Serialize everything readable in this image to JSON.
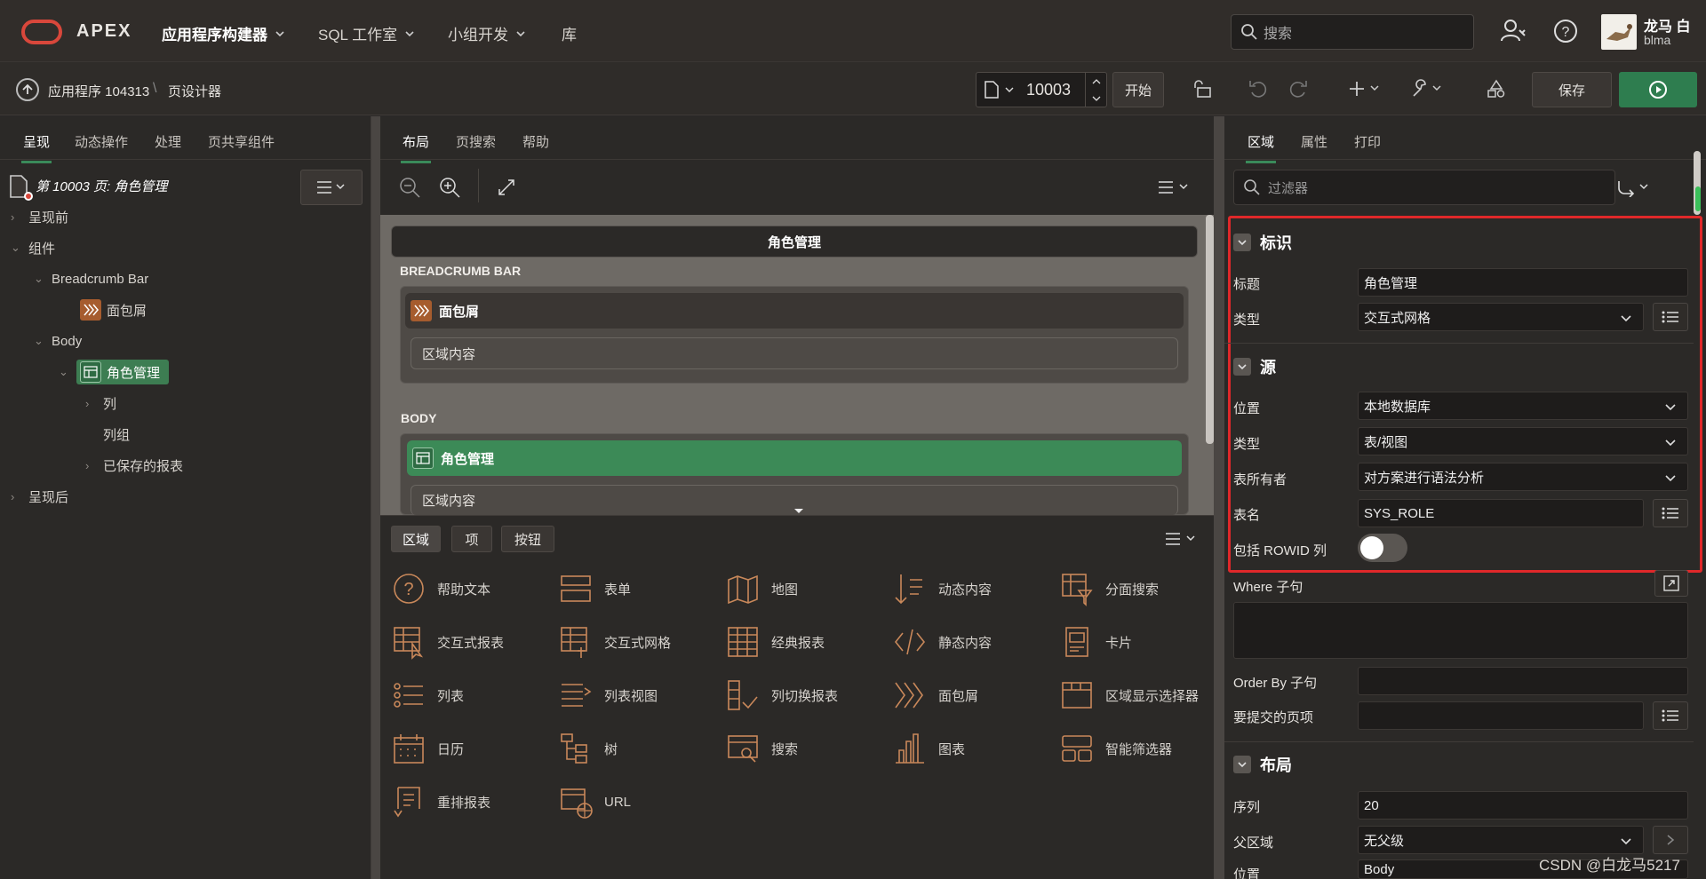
{
  "topnav": {
    "brand": "APEX",
    "menu": [
      {
        "label": "应用程序构建器",
        "active": true
      },
      {
        "label": "SQL 工作室",
        "active": false
      },
      {
        "label": "小组开发",
        "active": false
      },
      {
        "label": "库",
        "active": false
      }
    ],
    "search_placeholder": "搜索",
    "user_name": "龙马 白",
    "user_id": "blma"
  },
  "toolbar": {
    "back_label": "应用程序 104313",
    "separator": "\\",
    "breadcrumb_current": "页设计器",
    "page_number": "10003",
    "go_label": "开始",
    "save_label": "保存"
  },
  "left": {
    "tabs": [
      "呈现",
      "动态操作",
      "处理",
      "页共享组件"
    ],
    "page_title": "第 10003 页: 角色管理",
    "tree": {
      "pre_render": "呈现前",
      "components": "组件",
      "breadcrumb_bar": "Breadcrumb Bar",
      "breadcrumb_item": "面包屑",
      "body": "Body",
      "body_item": "角色管理",
      "columns": "列",
      "column_groups": "列组",
      "saved_reports": "已保存的报表",
      "post_render": "呈现后"
    }
  },
  "center": {
    "tabs": [
      "布局",
      "页搜索",
      "帮助"
    ],
    "canvas": {
      "page_header": "角色管理",
      "breadcrumb_bar_label": "BREADCRUMB BAR",
      "breadcrumb_region": "面包屑",
      "region_content_1": "区域内容",
      "body_label": "BODY",
      "body_region": "角色管理",
      "region_content_2": "区域内容"
    },
    "gallery_tabs": [
      "区域",
      "项",
      "按钮"
    ],
    "gallery": [
      {
        "label": "帮助文本",
        "icon": "help-text-icon"
      },
      {
        "label": "表单",
        "icon": "form-icon"
      },
      {
        "label": "地图",
        "icon": "map-icon"
      },
      {
        "label": "动态内容",
        "icon": "dynamic-content-icon"
      },
      {
        "label": "分面搜索",
        "icon": "faceted-search-icon"
      },
      {
        "label": "交互式报表",
        "icon": "interactive-report-icon"
      },
      {
        "label": "交互式网格",
        "icon": "interactive-grid-icon"
      },
      {
        "label": "经典报表",
        "icon": "classic-report-icon"
      },
      {
        "label": "静态内容",
        "icon": "static-content-icon"
      },
      {
        "label": "卡片",
        "icon": "cards-icon"
      },
      {
        "label": "列表",
        "icon": "list-icon"
      },
      {
        "label": "列表视图",
        "icon": "list-view-icon"
      },
      {
        "label": "列切换报表",
        "icon": "column-toggle-icon"
      },
      {
        "label": "面包屑",
        "icon": "breadcrumb-icon"
      },
      {
        "label": "区域显示选择器",
        "icon": "region-selector-icon"
      },
      {
        "label": "日历",
        "icon": "calendar-icon"
      },
      {
        "label": "树",
        "icon": "tree-icon"
      },
      {
        "label": "搜索",
        "icon": "search-region-icon"
      },
      {
        "label": "图表",
        "icon": "chart-icon"
      },
      {
        "label": "智能筛选器",
        "icon": "smart-filter-icon"
      },
      {
        "label": "重排报表",
        "icon": "reflow-report-icon"
      },
      {
        "label": "URL",
        "icon": "url-icon"
      }
    ]
  },
  "right": {
    "tabs": [
      "区域",
      "属性",
      "打印"
    ],
    "filter_placeholder": "过滤器",
    "sections": {
      "identity": "标识",
      "source": "源",
      "layout": "布局"
    },
    "props": {
      "title_label": "标题",
      "title_value": "角色管理",
      "type_label": "类型",
      "type_value": "交互式网格",
      "location_label": "位置",
      "location_value": "本地数据库",
      "src_type_label": "类型",
      "src_type_value": "表/视图",
      "owner_label": "表所有者",
      "owner_value": "对方案进行语法分析",
      "table_label": "表名",
      "table_value": "SYS_ROLE",
      "rowid_label": "包括 ROWID 列",
      "where_label": "Where 子句",
      "orderby_label": "Order By 子句",
      "submit_label": "要提交的页项",
      "seq_label": "序列",
      "seq_value": "20",
      "parent_label": "父区域",
      "parent_value": "无父级",
      "pos_label": "位置",
      "pos_value": "Body"
    }
  },
  "watermark": "CSDN @白龙马5217",
  "colors": {
    "accent_green": "#3a8a5a",
    "highlight_red": "#e0282a",
    "brand_red": "#d9473b",
    "icon_orange": "#c9885a"
  }
}
